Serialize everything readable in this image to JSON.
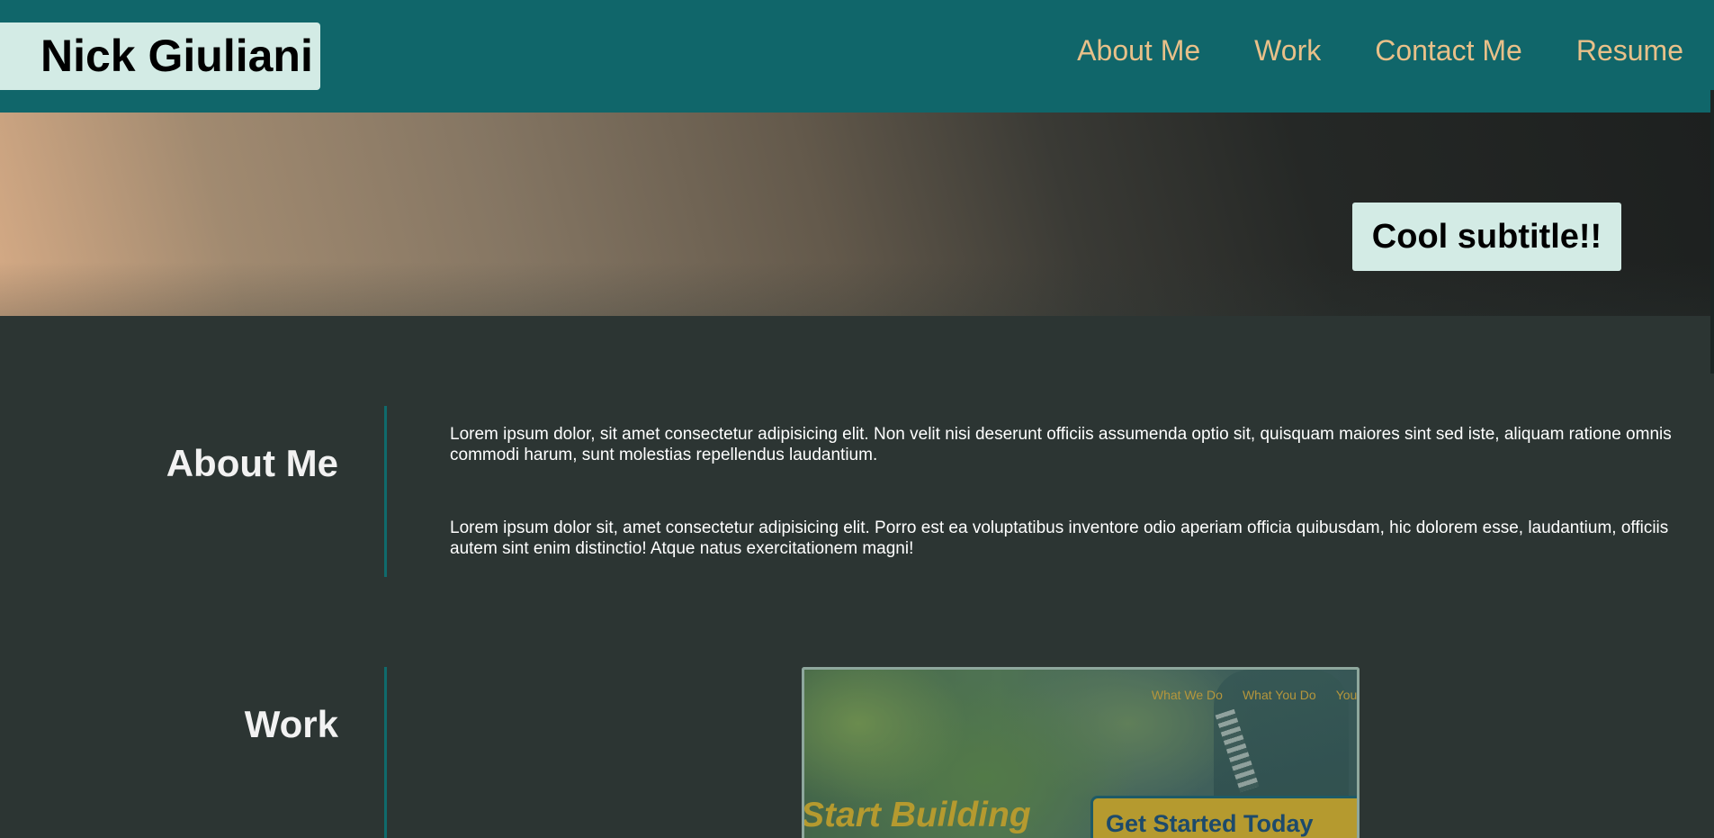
{
  "header": {
    "brand": "Nick Giuliani",
    "nav": [
      "About Me",
      "Work",
      "Contact Me",
      "Resume"
    ]
  },
  "hero": {
    "subtitle": "Cool subtitle!!"
  },
  "about": {
    "title": "About Me",
    "paragraphs": [
      "Lorem ipsum dolor, sit amet consectetur adipisicing elit. Non velit nisi deserunt officiis assumenda optio sit, quisquam maiores sint sed iste, aliquam ratione omnis commodi harum, sunt molestias repellendus laudantium.",
      "Lorem ipsum dolor sit, amet consectetur adipisicing elit. Porro est ea voluptatibus inventore odio aperiam officia quibusdam, hic dolorem esse, laudantium, officiis autem sint enim distinctio! Atque natus exercitationem magni!"
    ]
  },
  "work": {
    "title": "Work",
    "preview": {
      "nav": [
        "What We Do",
        "What You Do",
        "Your"
      ],
      "headline": "Start Building",
      "cta": "Get Started Today"
    }
  },
  "colors": {
    "header_bg": "#10666a",
    "brand_bg": "#d3ebe5",
    "nav_link": "#e8c089",
    "page_bg": "#2c3533",
    "divider": "#0f6a6c"
  }
}
